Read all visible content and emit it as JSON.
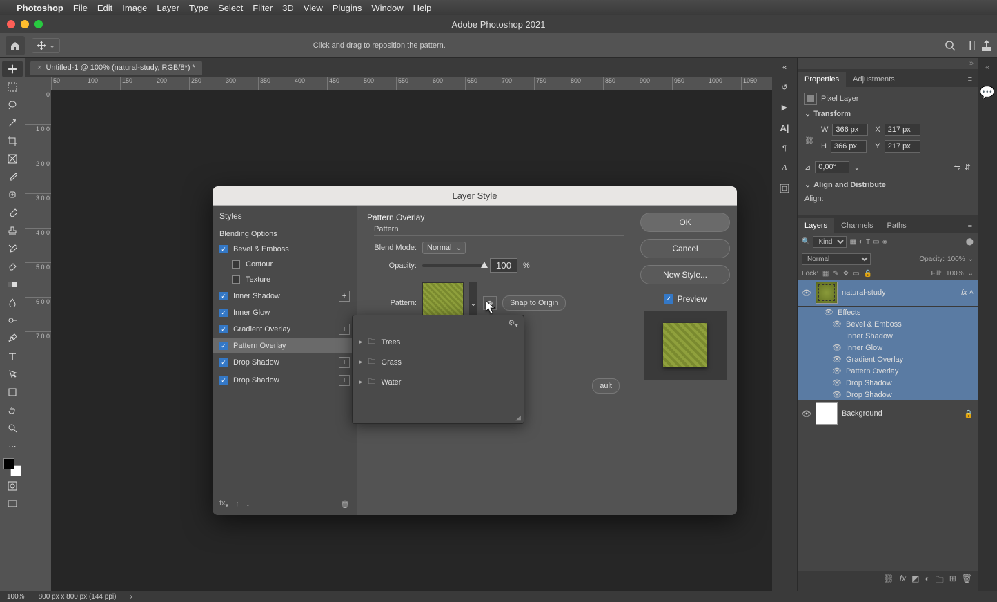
{
  "menubar": {
    "app": "Photoshop",
    "items": [
      "File",
      "Edit",
      "Image",
      "Layer",
      "Type",
      "Select",
      "Filter",
      "3D",
      "View",
      "Plugins",
      "Window",
      "Help"
    ]
  },
  "window_title": "Adobe Photoshop 2021",
  "optionbar": {
    "hint": "Click and drag to reposition the pattern."
  },
  "doc_tab": "Untitled-1 @ 100% (natural-study, RGB/8*) *",
  "ruler_h": [
    "50",
    "100",
    "150",
    "200",
    "250",
    "300",
    "350",
    "400",
    "450",
    "500",
    "550",
    "600",
    "650",
    "700",
    "750",
    "800",
    "850",
    "900",
    "950",
    "1000",
    "1050"
  ],
  "ruler_v": [
    "0",
    "1 0 0",
    "2 0 0",
    "3 0 0",
    "4 0 0",
    "5 0 0",
    "6 0 0",
    "7 0 0"
  ],
  "dialog": {
    "title": "Layer Style",
    "left_header": "Styles",
    "blending": "Blending Options",
    "items": [
      {
        "label": "Bevel & Emboss",
        "checked": true,
        "plus": false
      },
      {
        "label": "Contour",
        "checked": false,
        "indent": true
      },
      {
        "label": "Texture",
        "checked": false,
        "indent": true
      },
      {
        "label": "Inner Shadow",
        "checked": true,
        "plus": true
      },
      {
        "label": "Inner Glow",
        "checked": true,
        "plus": false
      },
      {
        "label": "Gradient Overlay",
        "checked": true,
        "plus": true
      },
      {
        "label": "Pattern Overlay",
        "checked": true,
        "plus": false,
        "active": true
      },
      {
        "label": "Drop Shadow",
        "checked": true,
        "plus": true
      },
      {
        "label": "Drop Shadow",
        "checked": true,
        "plus": true
      }
    ],
    "section": "Pattern Overlay",
    "sub": "Pattern",
    "blend_label": "Blend Mode:",
    "blend_value": "Normal",
    "opacity_label": "Opacity:",
    "opacity_value": "100",
    "opacity_unit": "%",
    "pattern_label": "Pattern:",
    "snap": "Snap to Origin",
    "default_fragment": "ault",
    "popup": {
      "items": [
        "Trees",
        "Grass",
        "Water"
      ]
    },
    "ok": "OK",
    "cancel": "Cancel",
    "newstyle": "New Style...",
    "preview": "Preview"
  },
  "properties": {
    "tabs": [
      "Properties",
      "Adjustments"
    ],
    "type": "Pixel Layer",
    "transform": "Transform",
    "w_label": "W",
    "w": "366 px",
    "h_label": "H",
    "h": "366 px",
    "x_label": "X",
    "x": "217 px",
    "y_label": "Y",
    "y": "217 px",
    "angle": "0,00°",
    "align_hdr": "Align and Distribute",
    "align_label": "Align:"
  },
  "layers": {
    "tabs": [
      "Layers",
      "Channels",
      "Paths"
    ],
    "kind": "Kind",
    "blend": "Normal",
    "opacity_label": "Opacity:",
    "opacity": "100%",
    "lock": "Lock:",
    "fill_label": "Fill:",
    "fill": "100%",
    "layer1": "natural-study",
    "effects": "Effects",
    "fx": [
      "Bevel & Emboss",
      "Inner Shadow",
      "Inner Glow",
      "Gradient Overlay",
      "Pattern Overlay",
      "Drop Shadow",
      "Drop Shadow"
    ],
    "bg": "Background"
  },
  "status": {
    "zoom": "100%",
    "info": "800 px x 800 px (144 ppi)"
  }
}
